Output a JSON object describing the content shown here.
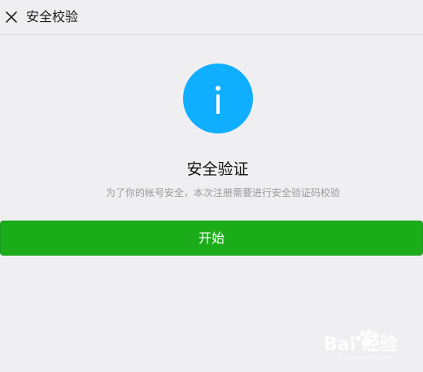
{
  "header": {
    "title": "安全校验",
    "close_icon": "close-icon"
  },
  "content": {
    "icon": "info-icon",
    "icon_color": "#10aeff",
    "title": "安全验证",
    "subtitle": "为了你的帐号安全，本次注册需要进行安全验证码校验"
  },
  "actions": {
    "start_label": "开始",
    "button_color": "#1aad19"
  },
  "watermark": {
    "text": "Bai 经验",
    "subtext": "jingyan.baidu.com"
  }
}
